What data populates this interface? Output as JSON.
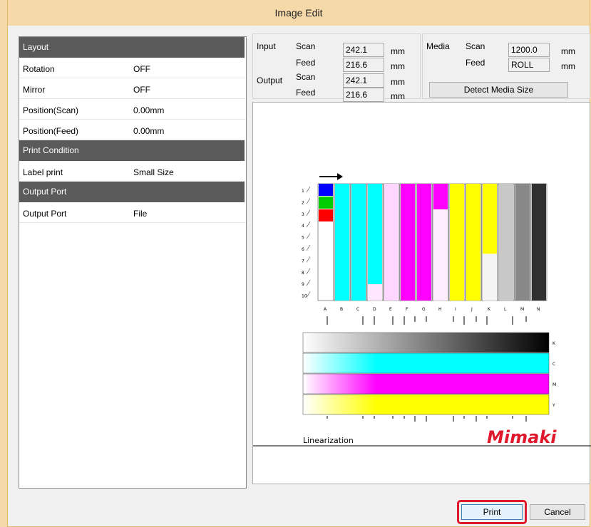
{
  "window": {
    "title": "Image Edit"
  },
  "properties": [
    {
      "type": "header",
      "label": "Layout"
    },
    {
      "type": "row",
      "key": "Rotation",
      "value": "OFF"
    },
    {
      "type": "row",
      "key": "Mirror",
      "value": "OFF"
    },
    {
      "type": "row",
      "key": "Position(Scan)",
      "value": "0.00mm"
    },
    {
      "type": "row",
      "key": "Position(Feed)",
      "value": "0.00mm"
    },
    {
      "type": "header",
      "label": "Print Condition"
    },
    {
      "type": "row",
      "key": "Label print",
      "value": "Small Size"
    },
    {
      "type": "header",
      "label": "Output Port"
    },
    {
      "type": "row",
      "key": "Output Port",
      "value": "File"
    }
  ],
  "size_info": {
    "input_label": "Input",
    "output_label": "Output",
    "scan_label": "Scan",
    "feed_label": "Feed",
    "unit": "mm",
    "input_scan": "242.1",
    "input_feed": "216.6",
    "output_scan": "242.1",
    "output_feed": "216.6"
  },
  "media": {
    "label": "Media",
    "scan_label": "Scan",
    "feed_label": "Feed",
    "scan": "1200.0",
    "feed": "ROLL",
    "unit": "mm",
    "detect_button": "Detect Media Size"
  },
  "preview": {
    "row_numbers": [
      "1",
      "2",
      "3",
      "4",
      "5",
      "6",
      "7",
      "8",
      "9",
      "10"
    ],
    "columns": [
      "A",
      "B",
      "C",
      "D",
      "E",
      "F",
      "G",
      "H",
      "I",
      "J",
      "K",
      "L",
      "M",
      "N"
    ],
    "gradient_labels": [
      "K",
      "C",
      "M",
      "Y"
    ],
    "linearization_label": "Linearization",
    "brand": "Mimaki",
    "colors": {
      "cyan": "#00ffff",
      "magenta": "#ff00ff",
      "yellow": "#ffff00",
      "black": "#000000"
    }
  },
  "buttons": {
    "print": "Print",
    "cancel": "Cancel"
  }
}
